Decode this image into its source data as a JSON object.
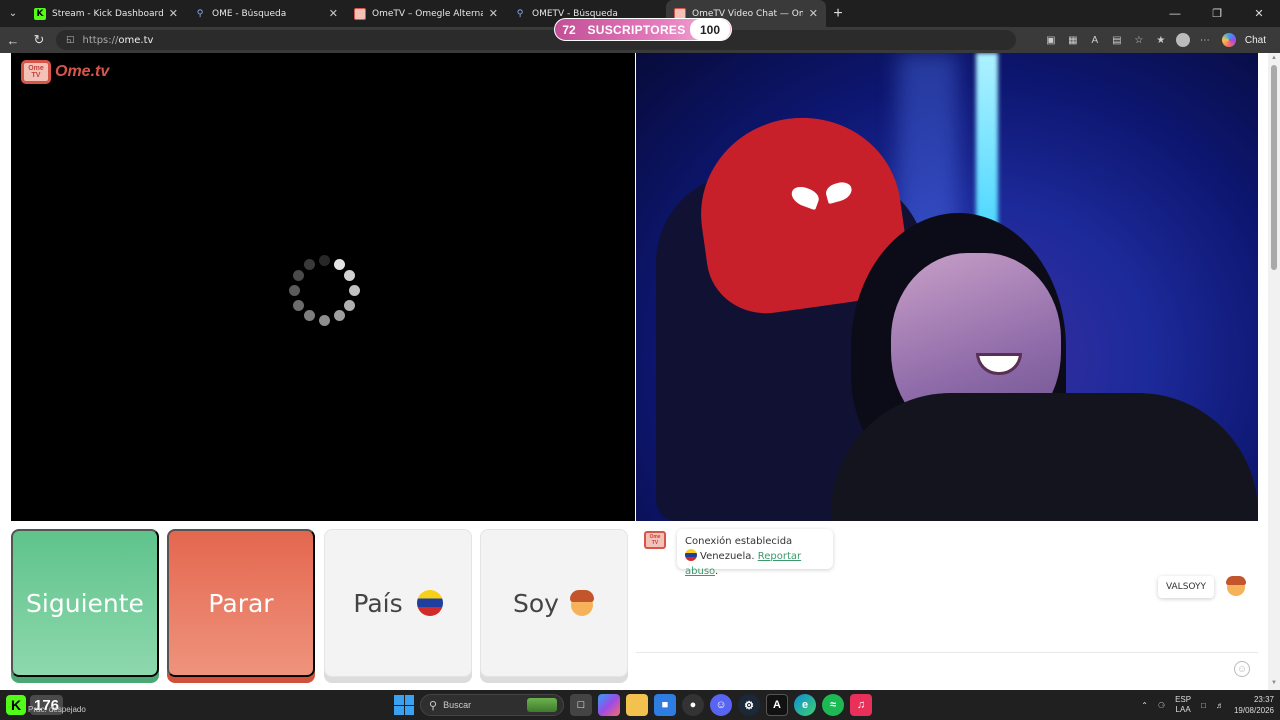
{
  "browser": {
    "tabs": [
      {
        "title": "Stream - Kick Dashboard",
        "icon": "kick-icon",
        "active": false
      },
      {
        "title": "OME - Búsqueda",
        "icon": "search-icon",
        "active": false
      },
      {
        "title": "OmeTV – Omegle Alternative for R",
        "icon": "ometv-icon",
        "active": false
      },
      {
        "title": "OMETV - Búsqueda",
        "icon": "search-icon",
        "active": false
      },
      {
        "title": "OmeTV Video Chat — Omegl",
        "icon": "ometv-icon",
        "active": true
      }
    ],
    "url_proto": "https://",
    "url_host": "ome.tv",
    "copilot_label": "Chat"
  },
  "overlay": {
    "subs_left": "72",
    "subs_label": "SUSCRIPTORES",
    "subs_right": "100"
  },
  "ometv": {
    "logo_text": "Ome.tv",
    "logo_tv_line1": "Ome",
    "logo_tv_line2": "TV",
    "buttons": {
      "next": "Siguiente",
      "stop": "Parar",
      "country": "País",
      "gender": "Soy"
    },
    "chat": {
      "status": "Conexión establecida",
      "country": "Venezuela.",
      "report": "Reportar abuso",
      "report_suffix": ".",
      "user_tag": "VALSOYY"
    },
    "country_flag": "venezuela-flag",
    "gender_icon": "boy-emoji"
  },
  "taskbar": {
    "kick_letter": "K",
    "kick_count": "176",
    "weather": "Prac. despejado",
    "search_placeholder": "Buscar",
    "lang_top": "ESP",
    "lang_bottom": "LAA",
    "time": "23:37",
    "date": "19/08/2026"
  },
  "colors": {
    "next_green": "#5fc38b",
    "stop_red": "#e4674f",
    "subs_pink": "#c24f96",
    "kick_green": "#53fc18",
    "link_green": "#3a9a6a"
  }
}
